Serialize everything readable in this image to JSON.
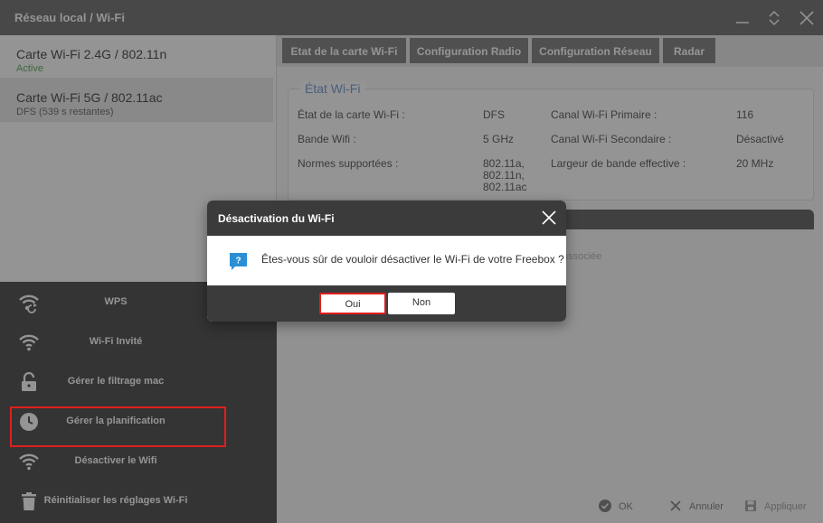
{
  "window": {
    "title": "Réseau local / Wi-Fi"
  },
  "cards": [
    {
      "name": "Carte Wi-Fi 2.4G / 802.11n",
      "sub": "Active"
    },
    {
      "name": "Carte Wi-Fi 5G / 802.11ac",
      "sub": "DFS (539 s restantes)"
    }
  ],
  "actions": [
    {
      "label": "WPS",
      "icon": "wps-icon"
    },
    {
      "label": "Wi-Fi Invité",
      "icon": "wifi-guest-icon"
    },
    {
      "label": "Gérer le filtrage mac",
      "icon": "lock-icon"
    },
    {
      "label": "Gérer la planification",
      "icon": "clock-icon"
    },
    {
      "label": "Désactiver le Wifi",
      "icon": "wifi-icon"
    },
    {
      "label": "Réinitialiser les réglages Wi-Fi",
      "icon": "trash-icon"
    }
  ],
  "tabs": [
    "Etat de la carte Wi-Fi",
    "Configuration Radio",
    "Configuration Réseau",
    "Radar"
  ],
  "status": {
    "legend": "État Wi-Fi",
    "rows": [
      {
        "label": "État de la carte Wi-Fi :",
        "value": "DFS",
        "label2": "Canal Wi-Fi Primaire :",
        "value2": "116"
      },
      {
        "label": "Bande Wifi :",
        "value": "5 GHz",
        "label2": "Canal Wi-Fi Secondaire :",
        "value2": "Désactivé"
      },
      {
        "label": "Normes supportées :",
        "value_lines": [
          "802.11a,",
          "802.11n,",
          "802.11ac"
        ],
        "label2": "Largeur de bande effective :",
        "value2": "20 MHz"
      }
    ]
  },
  "partial_text": "associée",
  "footer": {
    "ok": "OK",
    "cancel": "Annuler",
    "apply": "Appliquer"
  },
  "modal": {
    "title": "Désactivation du Wi-Fi",
    "message": "Êtes-vous sûr de vouloir désactiver le Wi-Fi de votre Freebox ?",
    "yes": "Oui",
    "no": "Non"
  },
  "colors": {
    "titlebar": "#7d7d7d",
    "accent_blue": "#7fa3d7",
    "active_green": "#6bb36b",
    "highlight_red": "#e01e1e",
    "modal_dark": "#3b3b3b"
  }
}
